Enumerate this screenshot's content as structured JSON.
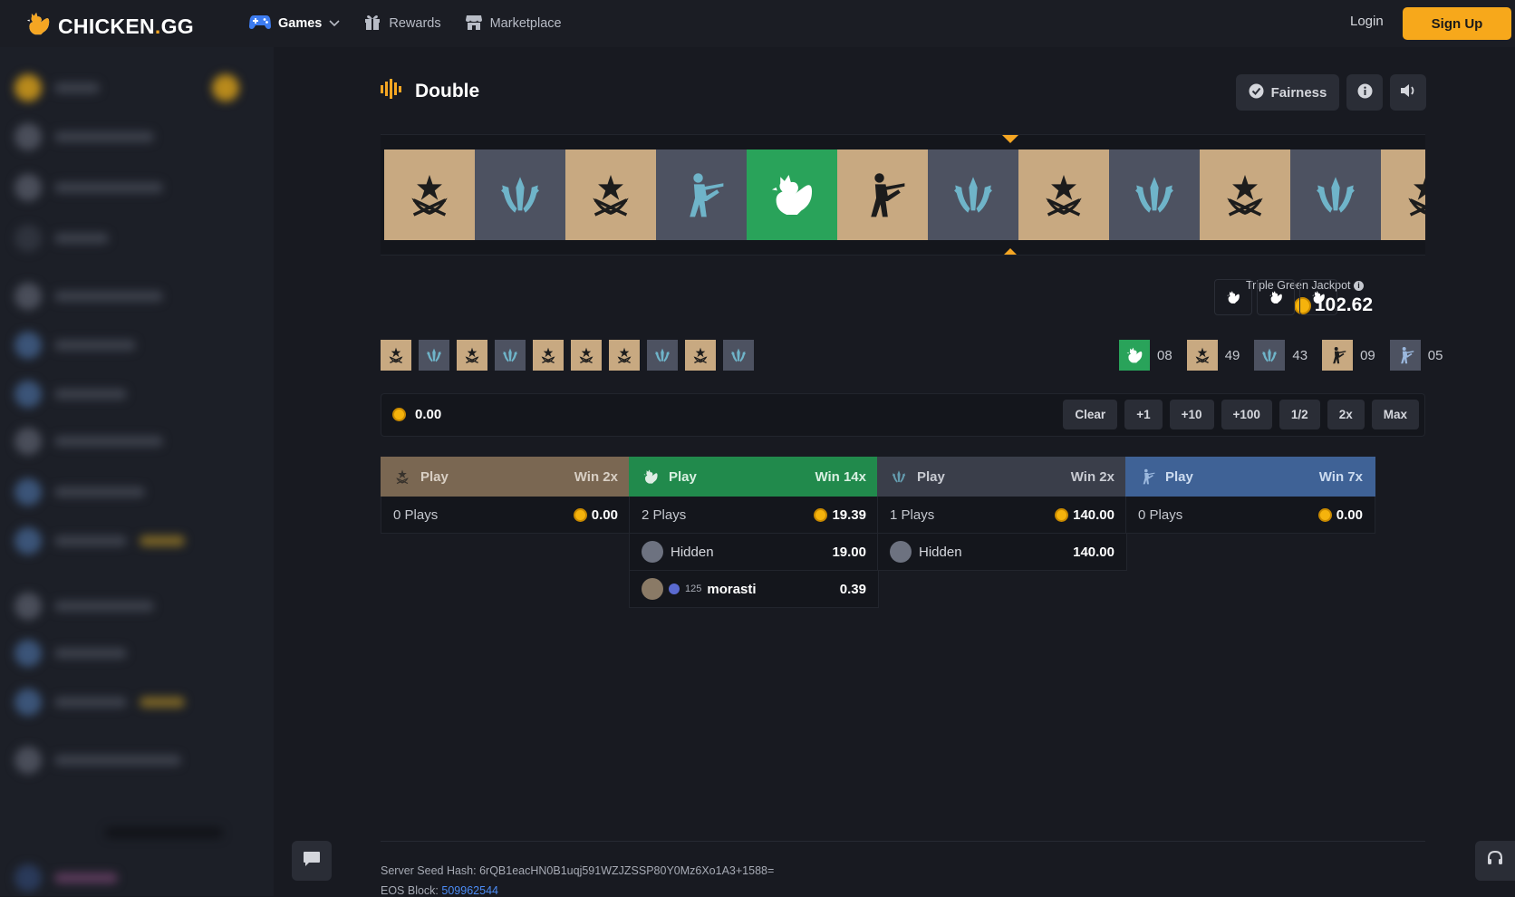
{
  "header": {
    "logo_text": "CHICKEN",
    "logo_dot": ".",
    "logo_tld": "GG",
    "nav": [
      {
        "label": "Games",
        "icon": "gamepad-icon"
      },
      {
        "label": "Rewards",
        "icon": "gift-icon"
      },
      {
        "label": "Marketplace",
        "icon": "store-icon"
      }
    ],
    "login_label": "Login",
    "signup_label": "Sign Up"
  },
  "game": {
    "title": "Double",
    "fairness_label": "Fairness",
    "roller": [
      "t",
      "ct",
      "t",
      "ct-agent",
      "chicken",
      "t-agent",
      "ct",
      "t",
      "ct",
      "t",
      "ct",
      "t"
    ],
    "jackpot_label": "Triple Green Jackpot",
    "jackpot_value": "102.62",
    "history": [
      "t",
      "ct",
      "t",
      "ct",
      "t",
      "t",
      "t",
      "ct",
      "t",
      "ct"
    ],
    "stats": [
      {
        "icon": "chicken",
        "count": "08"
      },
      {
        "icon": "t",
        "count": "49"
      },
      {
        "icon": "ct",
        "count": "43"
      },
      {
        "icon": "t-agent",
        "count": "09"
      },
      {
        "icon": "ct-agent",
        "count": "05"
      }
    ],
    "bet_amount": "0.00",
    "bet_buttons": [
      "Clear",
      "+1",
      "+10",
      "+100",
      "1/2",
      "2x",
      "Max"
    ]
  },
  "columns": [
    {
      "play_label": "Play",
      "win_label": "Win 2x",
      "plays": "0 Plays",
      "total": "0.00",
      "color": "#7a6752",
      "entries": []
    },
    {
      "play_label": "Play",
      "win_label": "Win 14x",
      "plays": "2 Plays",
      "total": "19.39",
      "color": "#218a4c",
      "entries": [
        {
          "name": "Hidden",
          "level": "",
          "amount": "19.00"
        },
        {
          "name": "morasti",
          "level": "125",
          "amount": "0.39"
        }
      ]
    },
    {
      "play_label": "Play",
      "win_label": "Win 2x",
      "plays": "1 Plays",
      "total": "140.00",
      "color": "#3a3e4a",
      "entries": [
        {
          "name": "Hidden",
          "level": "",
          "amount": "140.00"
        }
      ]
    },
    {
      "play_label": "Play",
      "win_label": "Win 7x",
      "plays": "0 Plays",
      "total": "0.00",
      "color": "#3f6296",
      "entries": []
    }
  ],
  "footer": {
    "seed_label": "Server Seed Hash:",
    "seed_value": "6rQB1eacHN0B1uqj591WZJZSSP80Y0Mz6Xo1A3+1588=",
    "eos_label": "EOS Block:",
    "eos_value": "509962544"
  },
  "colors": {
    "accent": "#f7a81b",
    "green": "#29a35a",
    "tan": "#c8a981",
    "grey": "#4d5261",
    "ct_blue": "#6fb4c9"
  }
}
